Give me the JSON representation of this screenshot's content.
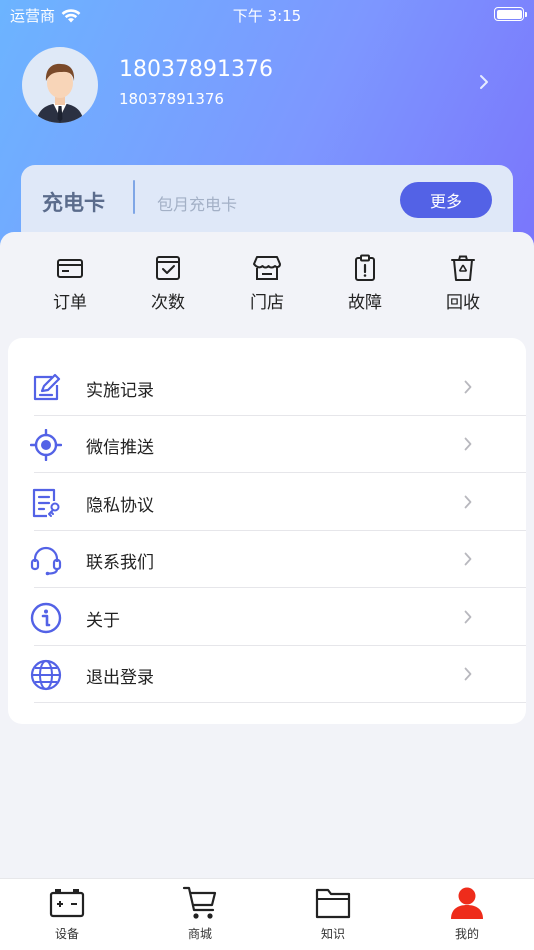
{
  "status_bar": {
    "carrier": "运营商",
    "time": "下午 3:15"
  },
  "profile": {
    "name": "18037891376",
    "subtitle": "18037891376"
  },
  "card": {
    "title": "充电卡",
    "subtitle": "包月充电卡",
    "more_label": "更多"
  },
  "quick_actions": [
    {
      "label": "订单",
      "icon": "card-icon"
    },
    {
      "label": "次数",
      "icon": "calendar-check-icon"
    },
    {
      "label": "门店",
      "icon": "store-icon"
    },
    {
      "label": "故障",
      "icon": "clipboard-alert-icon"
    },
    {
      "label": "回收",
      "icon": "recycle-bin-icon"
    }
  ],
  "menu": [
    {
      "label": "实施记录",
      "icon": "edit-record-icon"
    },
    {
      "label": "微信推送",
      "icon": "target-icon"
    },
    {
      "label": "隐私协议",
      "icon": "document-key-icon"
    },
    {
      "label": "联系我们",
      "icon": "headset-icon"
    },
    {
      "label": "关于",
      "icon": "info-icon"
    },
    {
      "label": "退出登录",
      "icon": "globe-icon"
    }
  ],
  "tabs": [
    {
      "label": "设备",
      "icon": "battery-icon",
      "active": false
    },
    {
      "label": "商城",
      "icon": "cart-icon",
      "active": false
    },
    {
      "label": "知识",
      "icon": "folder-icon",
      "active": false
    },
    {
      "label": "我的",
      "icon": "person-icon",
      "active": true
    }
  ],
  "colors": {
    "accent": "#5362e6",
    "active_tab": "#ee2c1b",
    "icon": "#5362e6"
  }
}
